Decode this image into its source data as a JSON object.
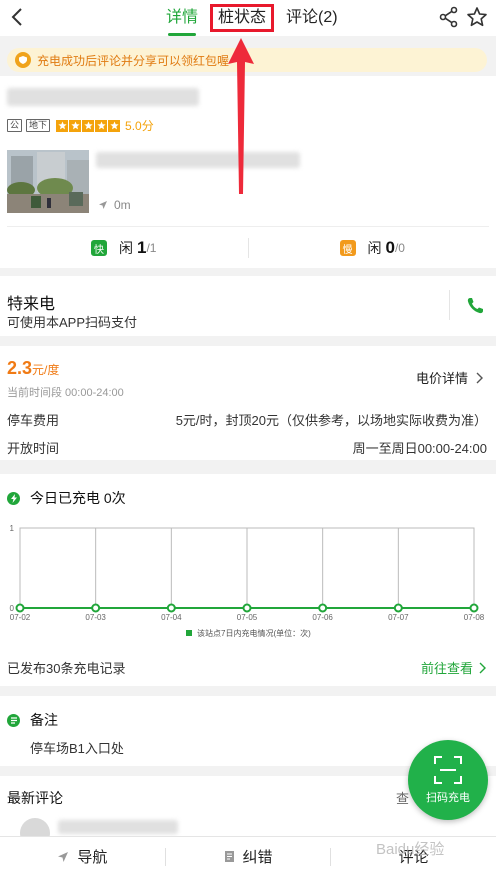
{
  "header": {
    "tabs": [
      {
        "label": "详情"
      },
      {
        "label": "桩状态"
      },
      {
        "label": "评论(2)"
      }
    ]
  },
  "notice": {
    "text": "充电成功后评论并分享可以领红包喔"
  },
  "station": {
    "tags": [
      "公",
      "地下"
    ],
    "rating": "5.0分",
    "distance": "0m",
    "slots": {
      "fast": {
        "badge": "快",
        "label": "闲",
        "count": "1",
        "total": "/1"
      },
      "slow": {
        "badge": "慢",
        "label": "闲",
        "count": "0",
        "total": "/0"
      }
    }
  },
  "operator": {
    "name": "特来电",
    "subtitle": "可使用本APP扫码支付"
  },
  "price": {
    "value": "2.3",
    "unit": "元/度",
    "time": "当前时间段 00:00-24:00",
    "detail_link": "电价详情",
    "rows": [
      {
        "label": "停车费用",
        "value": "5元/时，封顶20元（仅供参考，以场地实际收费为准）"
      },
      {
        "label": "开放时间",
        "value": "周一至周日00:00-24:00"
      }
    ]
  },
  "charges": {
    "title": "今日已充电 0次",
    "records_text": "已发布30条充电记录",
    "records_link": "前往查看"
  },
  "chart_data": {
    "type": "line",
    "categories": [
      "07-02",
      "07-03",
      "07-04",
      "07-05",
      "07-06",
      "07-07",
      "07-08"
    ],
    "series": [
      {
        "name": "该站点7日内充电情况(单位：次)",
        "values": [
          0,
          0,
          0,
          0,
          0,
          0,
          0
        ]
      }
    ],
    "ylim": [
      0,
      1
    ],
    "yticks": [
      "0",
      "1"
    ],
    "color": "#21a63a",
    "grid": true,
    "legend": "bottom-center"
  },
  "remarks": {
    "title": "备注",
    "text": "停车场B1入口处"
  },
  "comments": {
    "title": "最新评论",
    "more": "查"
  },
  "fab": {
    "label": "扫码充电"
  },
  "bottombar": {
    "items": [
      {
        "label": "导航",
        "icon": "navigation-icon"
      },
      {
        "label": "纠错",
        "icon": "report-icon"
      },
      {
        "label": "评论",
        "icon": "comment-icon"
      }
    ]
  },
  "watermark": "Baidu经验",
  "colors": {
    "primary": "#21a63a",
    "accent": "#f07a14",
    "highlight": "#e8192c"
  }
}
